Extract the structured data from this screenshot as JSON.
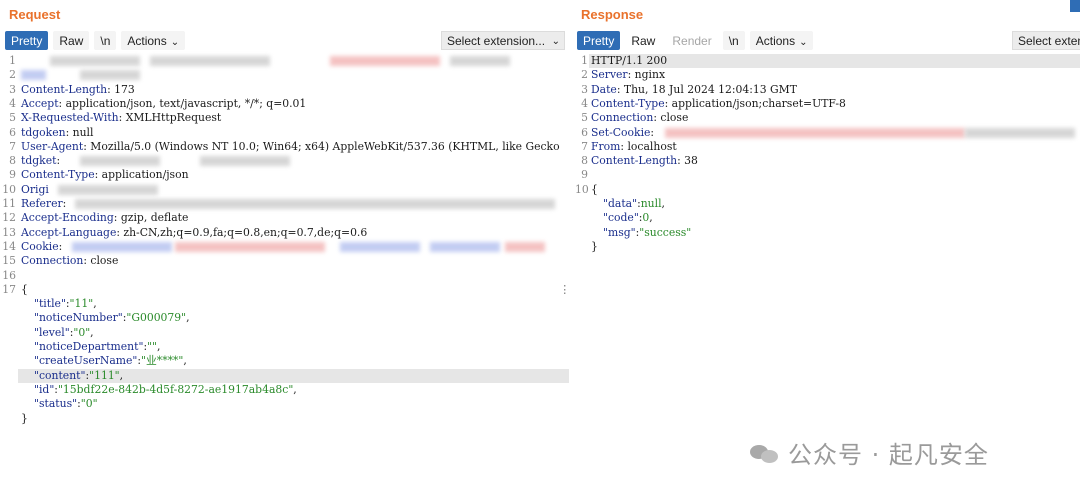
{
  "request": {
    "title": "Request",
    "toolbar": {
      "pretty": "Pretty",
      "raw": "Raw",
      "newline": "\\n",
      "actions": "Actions"
    },
    "select_extension": "Select extension...",
    "lines": [
      {
        "n": "1",
        "k": "",
        "v": ""
      },
      {
        "n": "2",
        "k": "",
        "v": ""
      },
      {
        "n": "3",
        "k": "Content-Length",
        "v": ": 173"
      },
      {
        "n": "4",
        "k": "Accept",
        "v": ": application/json, text/javascript, */*; q=0.01"
      },
      {
        "n": "5",
        "k": "X-Requested-With",
        "v": ": XMLHttpRequest"
      },
      {
        "n": "6",
        "k": "tdgoken",
        "v": ": null"
      },
      {
        "n": "7",
        "k": "User-Agent",
        "v": ": Mozilla/5.0 (Windows NT 10.0; Win64; x64) AppleWebKit/537.36 (KHTML, like Gecko"
      },
      {
        "n": "8",
        "k": "tdgket",
        "v": ":"
      },
      {
        "n": "9",
        "k": "Content-Type",
        "v": ": application/json"
      },
      {
        "n": "10",
        "k": "Origi",
        "v": ""
      },
      {
        "n": "11",
        "k": "Referer",
        "v": ":"
      },
      {
        "n": "12",
        "k": "Accept-Encoding",
        "v": ": gzip, deflate"
      },
      {
        "n": "13",
        "k": "Accept-Language",
        "v": ": zh-CN,zh;q=0.9,fa;q=0.8,en;q=0.7,de;q=0.6"
      },
      {
        "n": "14",
        "k": "Cookie",
        "v": ":"
      },
      {
        "n": "15",
        "k": "Connection",
        "v": ": close"
      },
      {
        "n": "16",
        "k": "",
        "v": ""
      },
      {
        "n": "17",
        "k": "",
        "v": "{"
      }
    ],
    "body": [
      {
        "k": "\"title\"",
        "v": "\"11\"",
        "sep": ":",
        "end": ","
      },
      {
        "k": "\"noticeNumber\"",
        "v": "\"G000079\"",
        "sep": ":",
        "end": ","
      },
      {
        "k": "\"level\"",
        "v": "\"0\"",
        "sep": ":",
        "end": ","
      },
      {
        "k": "\"noticeDepartment\"",
        "v": "\"\"",
        "sep": ":",
        "end": ","
      },
      {
        "k": "\"createUserName\"",
        "v": "\"业****\"",
        "sep": ":",
        "end": ","
      },
      {
        "k": "\"content\"",
        "v": "\"111\"",
        "sep": ":",
        "end": ","
      },
      {
        "k": "\"id\"",
        "v": "\"15bdf22e-842b-4d5f-8272-ae1917ab4a8c\"",
        "sep": ":",
        "end": ","
      },
      {
        "k": "\"status\"",
        "v": "\"0\"",
        "sep": ":",
        "end": ""
      }
    ],
    "close": "}"
  },
  "response": {
    "title": "Response",
    "toolbar": {
      "pretty": "Pretty",
      "raw": "Raw",
      "render": "Render",
      "newline": "\\n",
      "actions": "Actions"
    },
    "select_extension": "Select exten",
    "lines": [
      {
        "n": "1",
        "k": "",
        "v": "HTTP/1.1 200"
      },
      {
        "n": "2",
        "k": "Server",
        "v": ": nginx"
      },
      {
        "n": "3",
        "k": "Date",
        "v": ": Thu, 18 Jul 2024 12:04:13 GMT"
      },
      {
        "n": "4",
        "k": "Content-Type",
        "v": ": application/json;charset=UTF-8"
      },
      {
        "n": "5",
        "k": "Connection",
        "v": ": close"
      },
      {
        "n": "6",
        "k": "Set-Cookie",
        "v": ":"
      },
      {
        "n": "7",
        "k": "From",
        "v": ": localhost"
      },
      {
        "n": "8",
        "k": "Content-Length",
        "v": ": 38"
      },
      {
        "n": "9",
        "k": "",
        "v": ""
      },
      {
        "n": "10",
        "k": "",
        "v": "{"
      }
    ],
    "body": [
      {
        "k": "\"data\"",
        "v": "null",
        "sep": ":",
        "end": ","
      },
      {
        "k": "\"code\"",
        "v": "0",
        "sep": ":",
        "end": ","
      },
      {
        "k": "\"msg\"",
        "v": "\"success\"",
        "sep": ":",
        "end": ""
      }
    ],
    "close": "}"
  },
  "watermark": "公众号 · 起凡安全"
}
